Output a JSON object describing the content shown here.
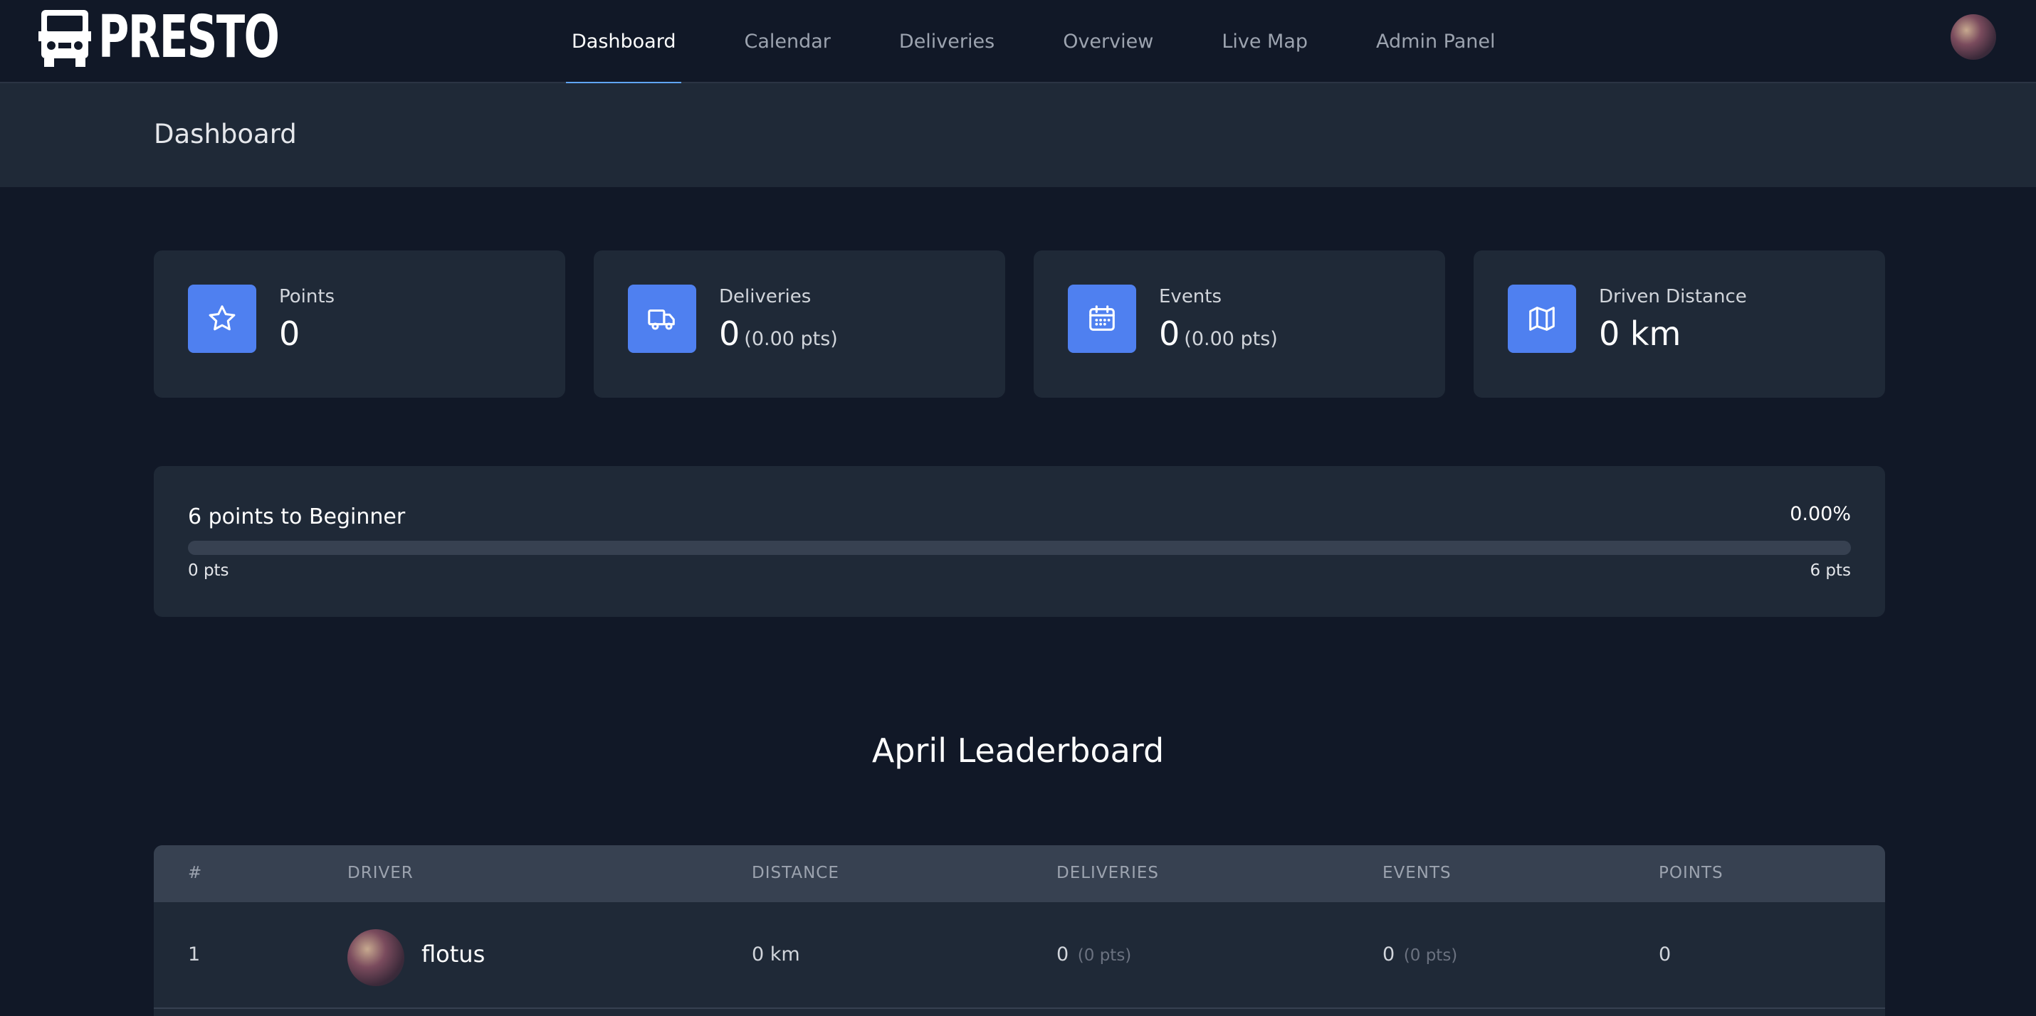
{
  "app": {
    "logo_text": "PRESTO"
  },
  "nav": {
    "items": [
      {
        "label": "Dashboard",
        "active": true
      },
      {
        "label": "Calendar"
      },
      {
        "label": "Deliveries"
      },
      {
        "label": "Overview"
      },
      {
        "label": "Live Map"
      },
      {
        "label": "Admin Panel"
      }
    ]
  },
  "header": {
    "title": "Dashboard"
  },
  "stats": {
    "points": {
      "label": "Points",
      "value": "0",
      "icon": "star-icon"
    },
    "deliveries": {
      "label": "Deliveries",
      "value": "0",
      "sub": "(0.00 pts)",
      "icon": "truck-icon"
    },
    "events": {
      "label": "Events",
      "value": "0",
      "sub": "(0.00 pts)",
      "icon": "calendar-icon"
    },
    "distance": {
      "label": "Driven Distance",
      "value": "0 km",
      "icon": "map-icon"
    }
  },
  "progress": {
    "title": "6 points to Beginner",
    "percent_label": "0.00%",
    "fraction": 0,
    "min_label": "0 pts",
    "max_label": "6 pts"
  },
  "leaderboard": {
    "title": "April Leaderboard",
    "columns": [
      "#",
      "DRIVER",
      "DISTANCE",
      "DELIVERIES",
      "EVENTS",
      "POINTS"
    ],
    "rows": [
      {
        "rank": "1",
        "driver": "flotus",
        "distance": "0 km",
        "deliveries": "0",
        "deliveries_pts": "(0 pts)",
        "events": "0",
        "events_pts": "(0 pts)",
        "points": "0"
      }
    ]
  },
  "colors": {
    "background": "#111827",
    "card": "#1f2937",
    "accent": "#4f80f0",
    "nav_active_underline": "#60a5fa"
  }
}
